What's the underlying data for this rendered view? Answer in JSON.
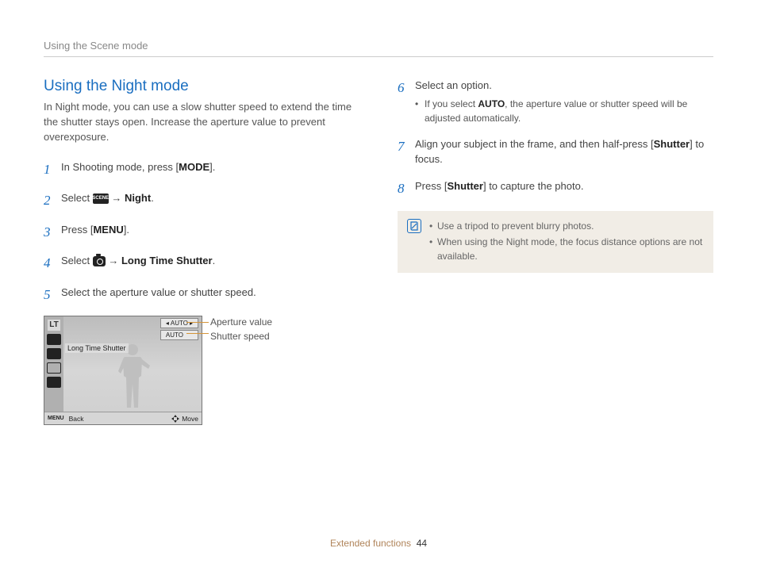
{
  "header": {
    "section_title": "Using the Scene mode"
  },
  "left": {
    "title": "Using the Night mode",
    "intro": "In Night mode, you can use a slow shutter speed to extend the time the shutter stays open. Increase the aperture value to prevent overexposure.",
    "steps": {
      "s1": {
        "num": "1",
        "prefix": "In Shooting mode, press [",
        "key": "MODE",
        "suffix": "]."
      },
      "s2": {
        "num": "2",
        "prefix": "Select ",
        "arrow": " → ",
        "target": "Night",
        "suffix": "."
      },
      "s3": {
        "num": "3",
        "prefix": "Press [",
        "key": "MENU",
        "suffix": "]."
      },
      "s4": {
        "num": "4",
        "prefix": "Select ",
        "arrow": " → ",
        "target": "Long Time Shutter",
        "suffix": "."
      },
      "s5": {
        "num": "5",
        "text": "Select the aperture value or shutter speed."
      }
    },
    "lcd": {
      "lt": "LT",
      "auto1": "AUTO",
      "auto2": "AUTO",
      "label": "Long Time Shutter",
      "menu": "MENU",
      "back": "Back",
      "move": "Move"
    },
    "callouts": {
      "aperture": "Aperture value",
      "shutter": "Shutter speed"
    }
  },
  "right": {
    "steps": {
      "s6": {
        "num": "6",
        "text": "Select an option.",
        "bullet_pre": "If you select ",
        "bullet_key": "AUTO",
        "bullet_post": ", the aperture value or shutter speed will be adjusted automatically."
      },
      "s7": {
        "num": "7",
        "pre": "Align your subject in the frame, and then half-press [",
        "key": "Shutter",
        "post": "] to focus."
      },
      "s8": {
        "num": "8",
        "pre": "Press [",
        "key": "Shutter",
        "post": "] to capture the photo."
      }
    },
    "note": {
      "n1": "Use a tripod to prevent blurry photos.",
      "n2": "When using the Night mode, the focus distance options are not available."
    }
  },
  "footer": {
    "section": "Extended functions",
    "page": "44"
  }
}
